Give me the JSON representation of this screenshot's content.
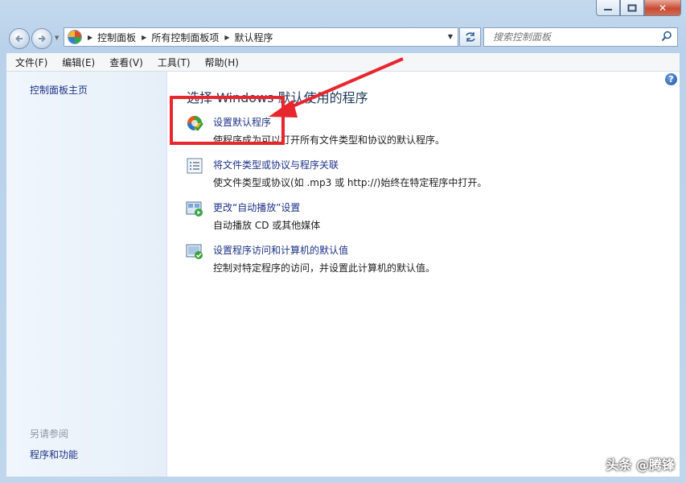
{
  "window": {
    "caption": {
      "minimize": "—",
      "maximize": "□",
      "close": "✕"
    }
  },
  "address": {
    "crumbs": [
      "控制面板",
      "所有控制面板项",
      "默认程序"
    ],
    "search_placeholder": "搜索控制面板"
  },
  "menu": [
    "文件(F)",
    "编辑(E)",
    "查看(V)",
    "工具(T)",
    "帮助(H)"
  ],
  "sidebar": {
    "home_link": "控制面板主页",
    "see_also_title": "另请参阅",
    "see_also_link": "程序和功能"
  },
  "main": {
    "heading": "选择 Windows 默认使用的程序",
    "tasks": [
      {
        "link": "设置默认程序",
        "desc": "使程序成为可以打开所有文件类型和协议的默认程序。",
        "icon": "default-programs-icon"
      },
      {
        "link": "将文件类型或协议与程序关联",
        "desc": "使文件类型或协议(如 .mp3 或 http://)始终在特定程序中打开。",
        "icon": "file-association-icon"
      },
      {
        "link": "更改“自动播放”设置",
        "desc": "自动播放 CD 或其他媒体",
        "icon": "autoplay-icon"
      },
      {
        "link": "设置程序访问和计算机的默认值",
        "desc": "控制对特定程序的访问，并设置此计算机的默认值。",
        "icon": "program-access-icon"
      }
    ]
  },
  "watermark": "头条 @腾锋",
  "colors": {
    "link": "#1e3287",
    "annotation": "#e8262e",
    "heading": "#1e395b"
  }
}
